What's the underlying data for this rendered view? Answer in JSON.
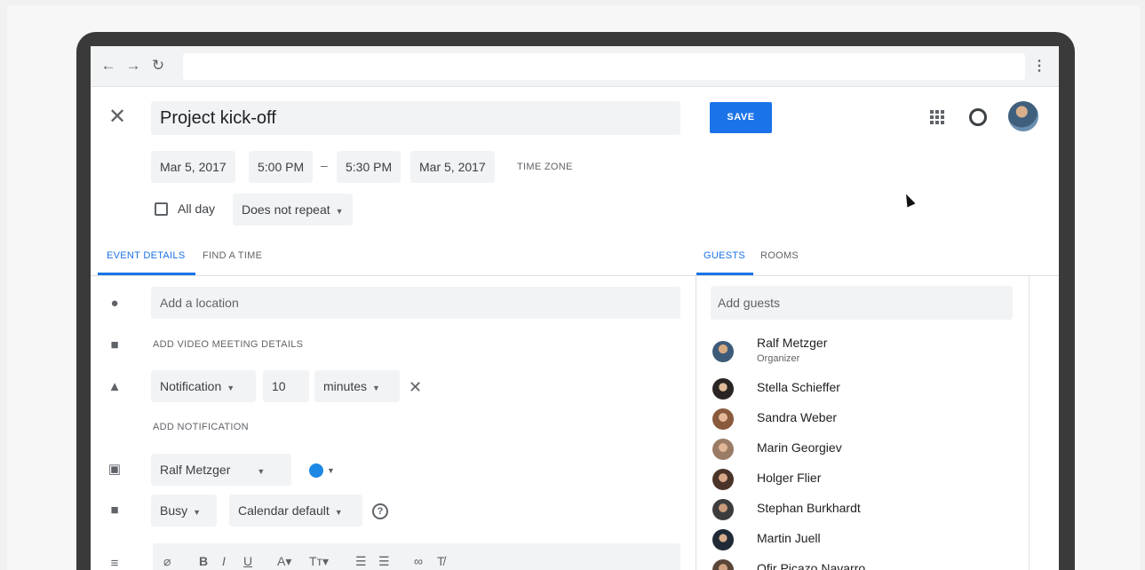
{
  "event": {
    "title": "Project kick-off",
    "save_label": "SAVE",
    "start_date": "Mar 5, 2017",
    "start_time": "5:00 PM",
    "separator": "–",
    "end_time": "5:30 PM",
    "end_date": "Mar 5, 2017",
    "time_zone_label": "TIME ZONE",
    "all_day_label": "All day",
    "repeat_value": "Does not repeat"
  },
  "tabs": {
    "left": [
      "EVENT DETAILS",
      "FIND A TIME"
    ],
    "right": [
      "GUESTS",
      "ROOMS"
    ]
  },
  "details": {
    "location_placeholder": "Add a location",
    "video_link": "ADD VIDEO MEETING DETAILS",
    "notification_type": "Notification",
    "notification_value": "10",
    "notification_unit": "minutes",
    "add_notification": "ADD NOTIFICATION",
    "calendar_owner": "Ralf Metzger",
    "calendar_color": "#1e88e5",
    "availability": "Busy",
    "visibility": "Calendar default",
    "help_glyph": "?"
  },
  "guests": {
    "placeholder": "Add guests",
    "list": [
      {
        "name": "Ralf Metzger",
        "role": "Organizer"
      },
      {
        "name": "Stella Schieffer"
      },
      {
        "name": "Sandra Weber"
      },
      {
        "name": "Marin Georgiev"
      },
      {
        "name": "Holger Flier"
      },
      {
        "name": "Stephan Burkhardt"
      },
      {
        "name": "Martin Juell"
      },
      {
        "name": "Ofir Picazo Navarro"
      }
    ]
  },
  "icons": [
    "back-arrow-icon",
    "forward-arrow-icon",
    "reload-icon",
    "kebab-menu-icon",
    "close-icon",
    "apps-grid-icon",
    "notifications-icon",
    "location-pin-icon",
    "video-camera-icon",
    "bell-icon",
    "calendar-icon",
    "briefcase-icon",
    "description-icon",
    "attachment-icon",
    "help-icon"
  ]
}
